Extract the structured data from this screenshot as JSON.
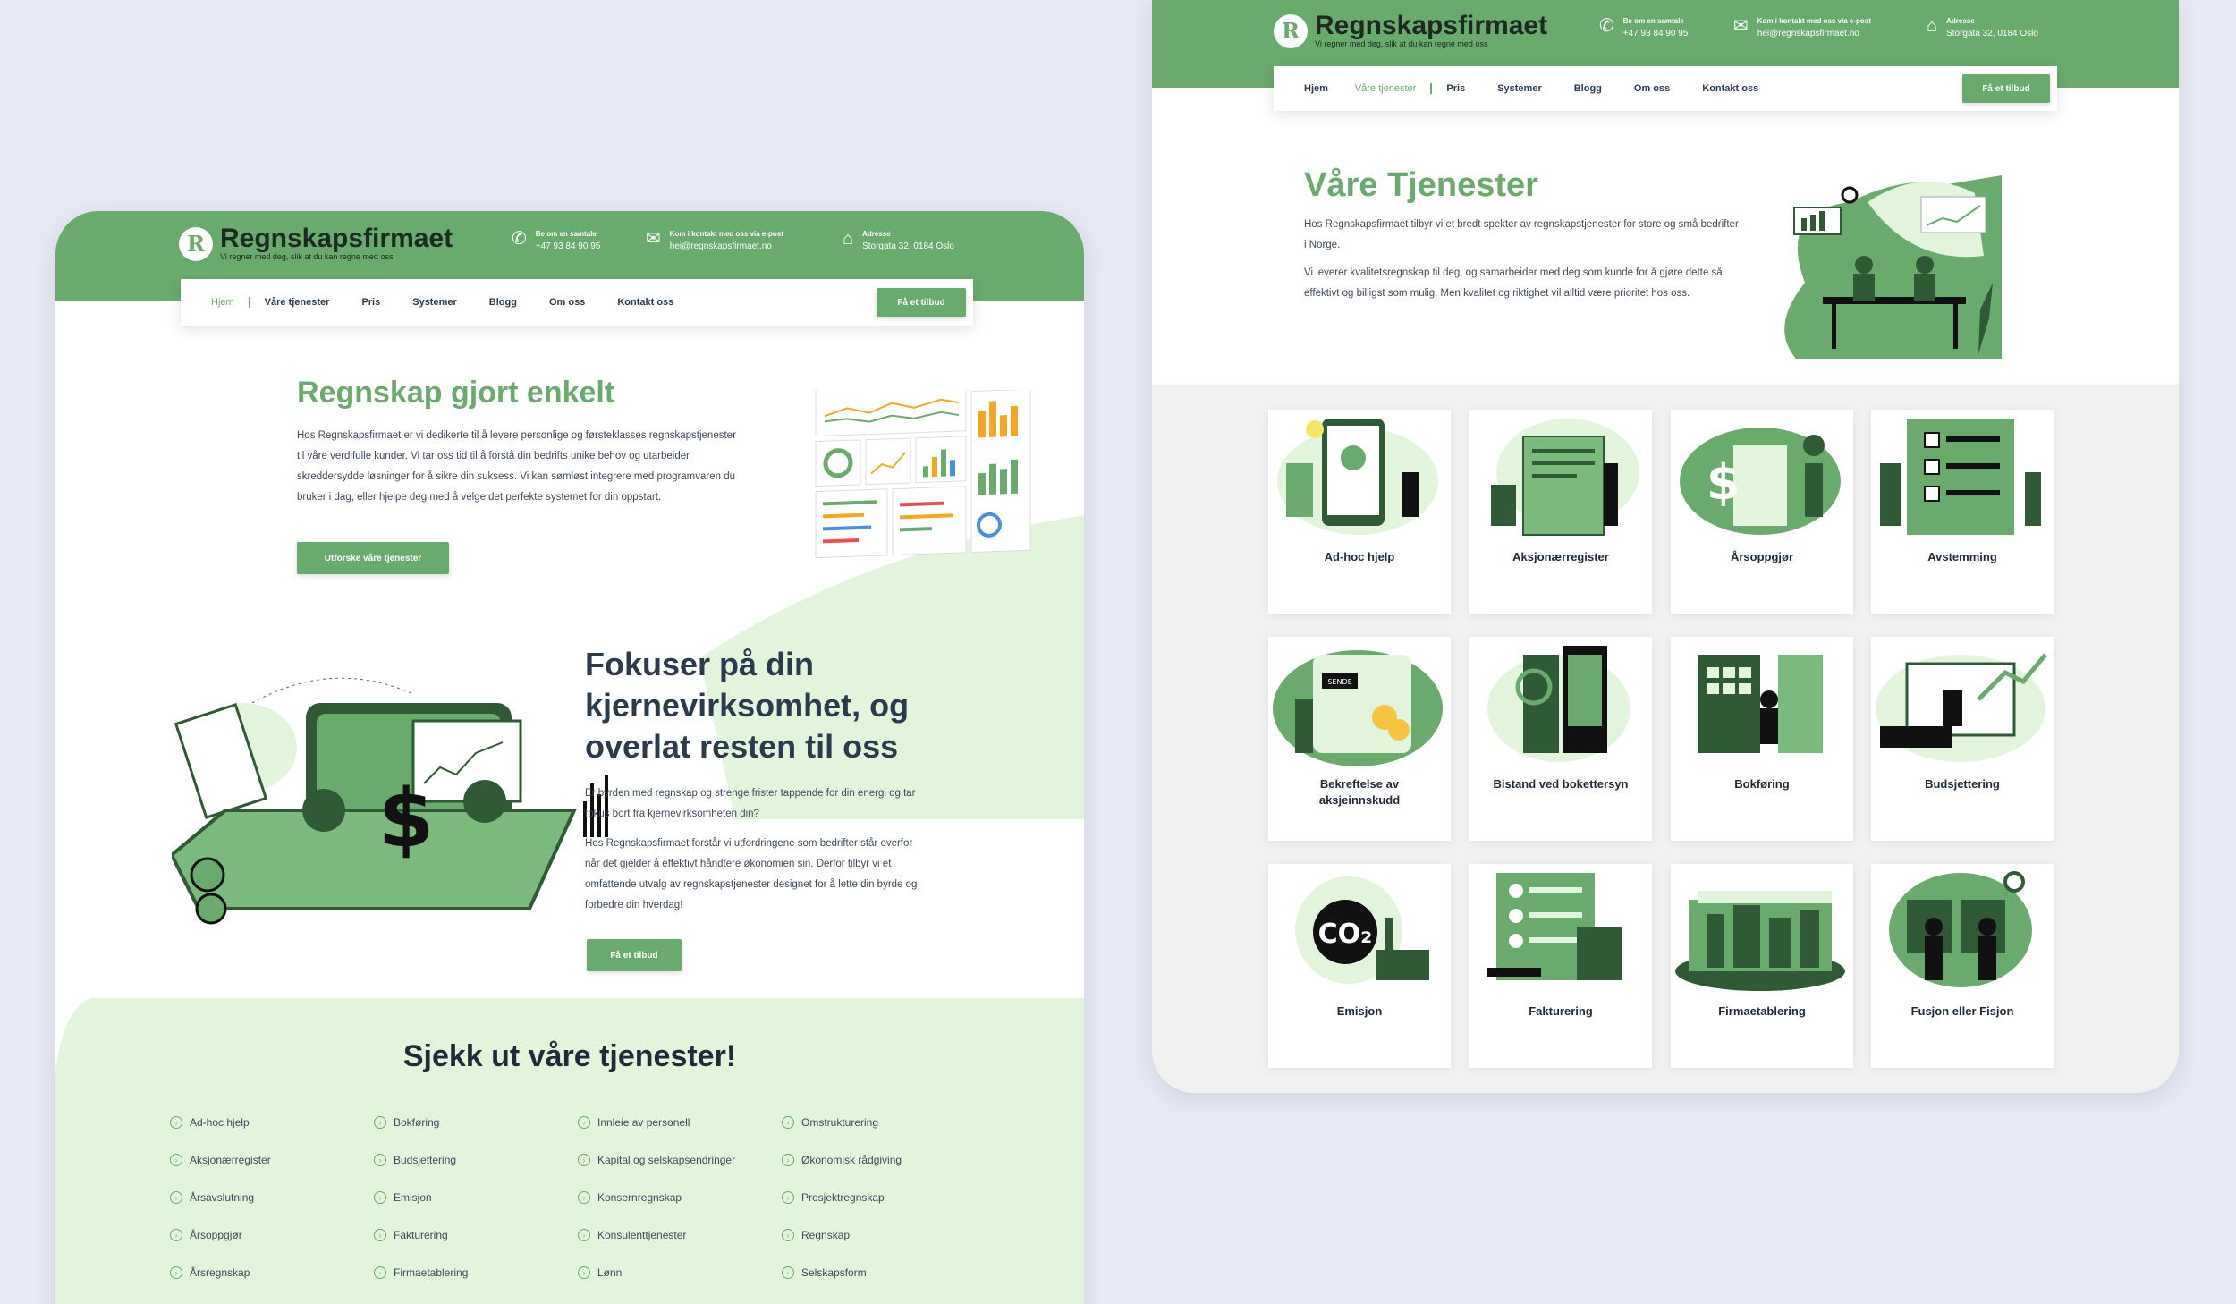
{
  "brand": {
    "name": "Regnskapsfirmaet",
    "tagline": "Vi regner med deg, slik at du kan regne med oss",
    "logo_letter": "R"
  },
  "contact": {
    "phone_label": "Be om en samtale",
    "phone": "+47 93 84 90 95",
    "email_label": "Kom i kontakt med oss via e-post",
    "email": "hei@regnskapsfirmaet.no",
    "address_label": "Adresse",
    "address": "Storgata 32, 0184 Oslo"
  },
  "nav": {
    "items": [
      "Hjem",
      "Våre tjenester",
      "Pris",
      "Systemer",
      "Blogg",
      "Om oss",
      "Kontakt oss"
    ],
    "cta": "Få et tilbud"
  },
  "home": {
    "hero_title": "Regnskap gjort enkelt",
    "hero_text": "Hos Regnskapsfirmaet er vi dedikerte til å levere personlige og førsteklasses regnskapstjenester til våre verdifulle kunder. Vi tar oss tid til å forstå din bedrifts unike behov og utarbeider skreddersydde løsninger for å sikre din suksess. Vi kan sømløst integrere med programvaren du bruker i dag, eller hjelpe deg med å velge det perfekte systemet for din oppstart.",
    "hero_button": "Utforske våre tjenester",
    "focus_title": "Fokuser på din kjernevirksomhet, og overlat resten til oss",
    "focus_p1": "Er byrden med regnskap og strenge frister tappende for din energi og tar fokus bort fra kjernevirksomheten din?",
    "focus_p2": "Hos Regnskapsfirmaet forstår vi utfordringene som bedrifter står overfor når det gjelder å effektivt håndtere økonomien sin. Derfor tilbyr vi et omfattende utvalg av regnskapstjenester designet for å lette din byrde og forbedre din hverdag!",
    "focus_button": "Få et tilbud",
    "services_title": "Sjekk ut våre tjenester!",
    "services": [
      [
        "Ad-hoc hjelp",
        "Aksjonærregister",
        "Årsavslutning",
        "Årsoppgjør",
        "Årsregnskap"
      ],
      [
        "Bokføring",
        "Budsjettering",
        "Emisjon",
        "Fakturering",
        "Firmaetablering"
      ],
      [
        "Innleie av personell",
        "Kapital og selskapsendringer",
        "Konsernregnskap",
        "Konsulenttjenester",
        "Lønn"
      ],
      [
        "Omstrukturering",
        "Økonomisk rådgiving",
        "Prosjektregnskap",
        "Regnskap",
        "Selskapsform"
      ]
    ]
  },
  "services_page": {
    "title": "Våre Tjenester",
    "p1": "Hos Regnskapsfirmaet tilbyr vi et bredt spekter av regnskapstjenester for store og små bedrifter i Norge.",
    "p2": "Vi leverer kvalitetsregnskap til deg, og samarbeider med deg som kunde for å gjøre dette så effektivt og billigst som mulig. Men kvalitet og riktighet vil alltid være prioritet hos oss.",
    "cards": [
      "Ad-hoc hjelp",
      "Aksjonærregister",
      "Årsoppgjør",
      "Avstemming",
      "Bekreftelse av aksjeinnskudd",
      "Bistand ved bokettersyn",
      "Bokføring",
      "Budsjettering",
      "Emisjon",
      "Fakturering",
      "Firmaetablering",
      "Fusjon eller Fisjon"
    ]
  },
  "illustration_text": {
    "co2": "CO₂",
    "send": "SENDE",
    "dollar": "$"
  },
  "colors": {
    "accent": "#6aaa6c",
    "light": "#e3f4dd",
    "dark": "#2f5a35",
    "page_bg": "#e7e9f4"
  }
}
